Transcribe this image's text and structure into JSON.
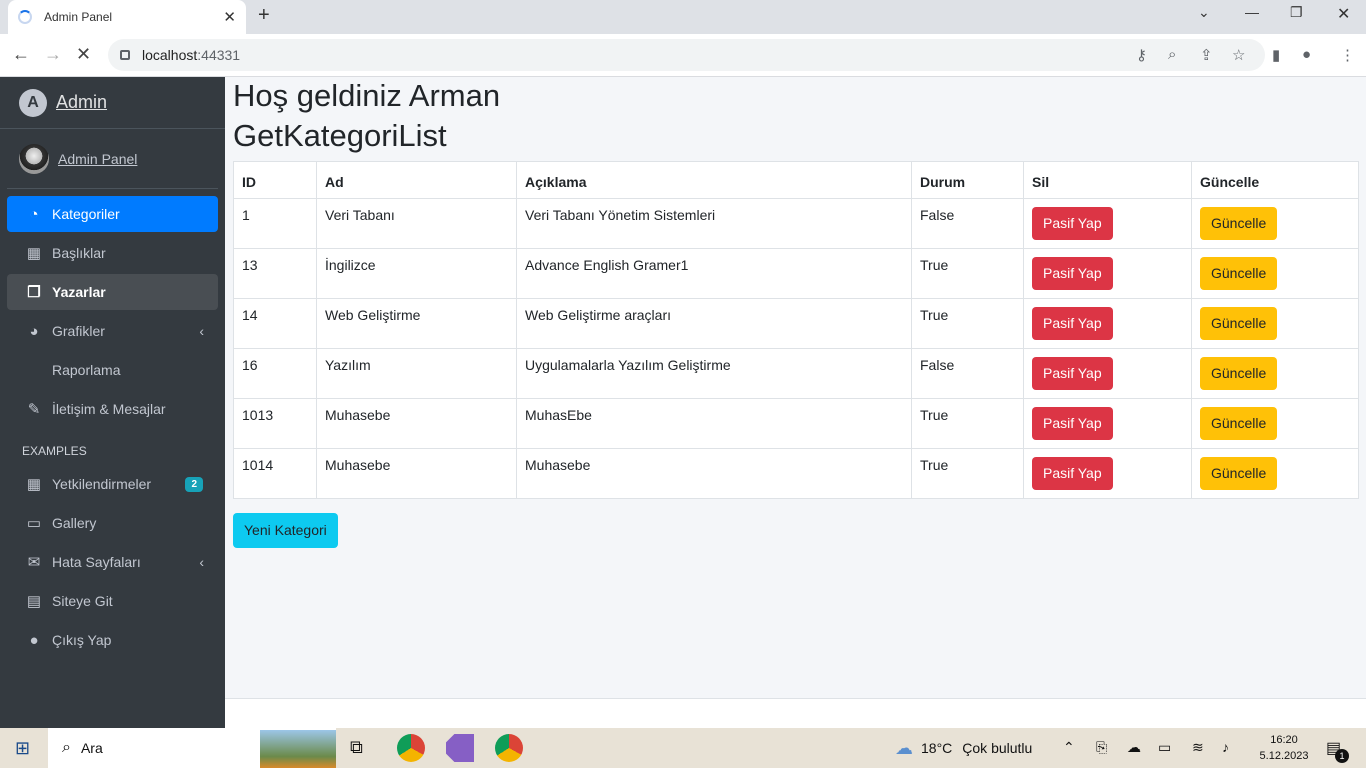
{
  "browser": {
    "tab_title": "Admin Panel",
    "url_host": "localhost",
    "url_port": ":44331"
  },
  "sidebar": {
    "brand": "Admin",
    "user": "Admin Panel",
    "items": [
      {
        "label": "Kategoriler",
        "icon": "dashboard-icon",
        "glyph": "◔"
      },
      {
        "label": "Başlıklar",
        "icon": "grid-icon",
        "glyph": "▦"
      },
      {
        "label": "Yazarlar",
        "icon": "copy-icon",
        "glyph": "❐"
      },
      {
        "label": "Grafikler",
        "icon": "pie-chart-icon",
        "glyph": "◕"
      },
      {
        "label": "Raporlama",
        "icon": "",
        "glyph": ""
      },
      {
        "label": "İletişim & Mesajlar",
        "icon": "edit-icon",
        "glyph": "✎"
      }
    ],
    "header": "EXAMPLES",
    "examples": [
      {
        "label": "Yetkilendirmeler",
        "icon": "calendar-icon",
        "glyph": "▦",
        "badge": "2"
      },
      {
        "label": "Gallery",
        "icon": "image-icon",
        "glyph": "▭"
      },
      {
        "label": "Hata Sayfaları",
        "icon": "envelope-icon",
        "glyph": "✉"
      },
      {
        "label": "Siteye Git",
        "icon": "book-icon",
        "glyph": "▤"
      },
      {
        "label": "Çıkış Yap",
        "icon": "apple-icon",
        "glyph": "●"
      }
    ]
  },
  "main": {
    "welcome": "Hoş geldiniz Arman",
    "title": "GetKategoriList",
    "columns": [
      "ID",
      "Ad",
      "Açıklama",
      "Durum",
      "Sil",
      "Güncelle"
    ],
    "rows": [
      {
        "id": "1",
        "ad": "Veri Tabanı",
        "aciklama": "Veri Tabanı Yönetim Sistemleri",
        "durum": "False"
      },
      {
        "id": "13",
        "ad": "İngilizce",
        "aciklama": "Advance English Gramer1",
        "durum": "True"
      },
      {
        "id": "14",
        "ad": "Web Geliştirme",
        "aciklama": "Web Geliştirme araçları",
        "durum": "True"
      },
      {
        "id": "16",
        "ad": "Yazılım",
        "aciklama": "Uygulamalarla Yazılım Geliştirme",
        "durum": "False"
      },
      {
        "id": "1013",
        "ad": "Muhasebe",
        "aciklama": "MuhasEbe",
        "durum": "True"
      },
      {
        "id": "1014",
        "ad": "Muhasebe",
        "aciklama": "Muhasebe",
        "durum": "True"
      }
    ],
    "delete_label": "Pasif Yap",
    "update_label": "Güncelle",
    "new_button": "Yeni Kategori"
  },
  "taskbar": {
    "search_placeholder": "Ara",
    "weather_temp": "18°C",
    "weather_desc": "Çok bulutlu",
    "time": "16:20",
    "date": "5.12.2023",
    "notification_count": "1"
  }
}
